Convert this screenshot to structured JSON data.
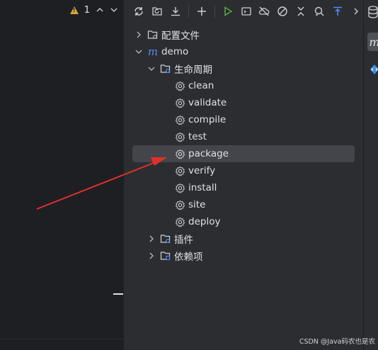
{
  "editor": {
    "warning_count": "1"
  },
  "maven_tree": {
    "items": [
      {
        "label": "配置文件"
      },
      {
        "label": "demo"
      },
      {
        "label": "生命周期"
      },
      {
        "label": "clean"
      },
      {
        "label": "validate"
      },
      {
        "label": "compile"
      },
      {
        "label": "test"
      },
      {
        "label": "package"
      },
      {
        "label": "verify"
      },
      {
        "label": "install"
      },
      {
        "label": "site"
      },
      {
        "label": "deploy"
      },
      {
        "label": "插件"
      },
      {
        "label": "依赖项"
      }
    ],
    "selected": "package"
  },
  "right_strip": {
    "maven_button_glyph": "m"
  },
  "watermark": "CSDN @Java码农也是农",
  "colors": {
    "accent_blue": "#548af7",
    "run_green": "#57a64a",
    "annotation_red": "#e0302b",
    "selection": "#43454a"
  }
}
